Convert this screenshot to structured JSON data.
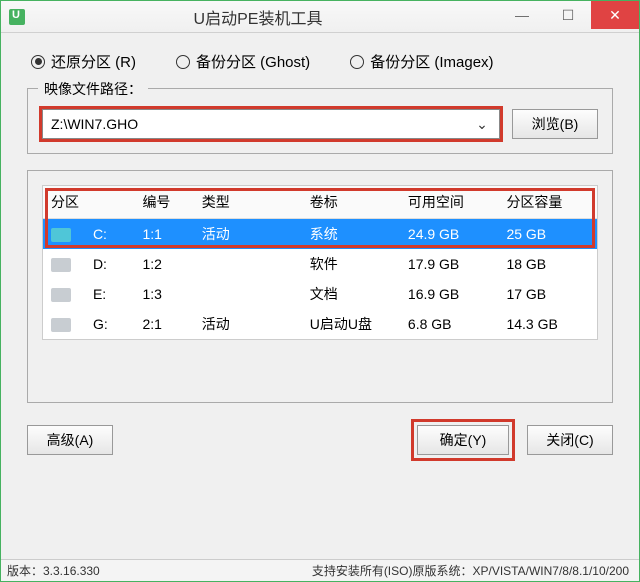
{
  "window": {
    "title": "U启动PE装机工具"
  },
  "radios": {
    "restore": "还原分区 (R)",
    "ghost": "备份分区 (Ghost)",
    "imagex": "备份分区 (Imagex)"
  },
  "path": {
    "group_label": "映像文件路径：",
    "value": "Z:\\WIN7.GHO",
    "browse": "浏览(B)"
  },
  "table": {
    "headers": {
      "partition": "分区",
      "number": "编号",
      "type": "类型",
      "label": "卷标",
      "free": "可用空间",
      "capacity": "分区容量"
    },
    "rows": [
      {
        "letter": "C:",
        "num": "1:1",
        "type": "活动",
        "label": "系统",
        "free": "24.9 GB",
        "cap": "25 GB",
        "selected": true
      },
      {
        "letter": "D:",
        "num": "1:2",
        "type": "",
        "label": "软件",
        "free": "17.9 GB",
        "cap": "18 GB",
        "selected": false
      },
      {
        "letter": "E:",
        "num": "1:3",
        "type": "",
        "label": "文档",
        "free": "16.9 GB",
        "cap": "17 GB",
        "selected": false
      },
      {
        "letter": "G:",
        "num": "2:1",
        "type": "活动",
        "label": "U启动U盘",
        "free": "6.8 GB",
        "cap": "14.3 GB",
        "selected": false
      }
    ]
  },
  "buttons": {
    "advanced": "高级(A)",
    "ok": "确定(Y)",
    "close": "关闭(C)"
  },
  "status": {
    "version": "版本：3.3.16.330",
    "support": "支持安装所有(ISO)原版系统：XP/VISTA/WIN7/8/8.1/10/200"
  }
}
